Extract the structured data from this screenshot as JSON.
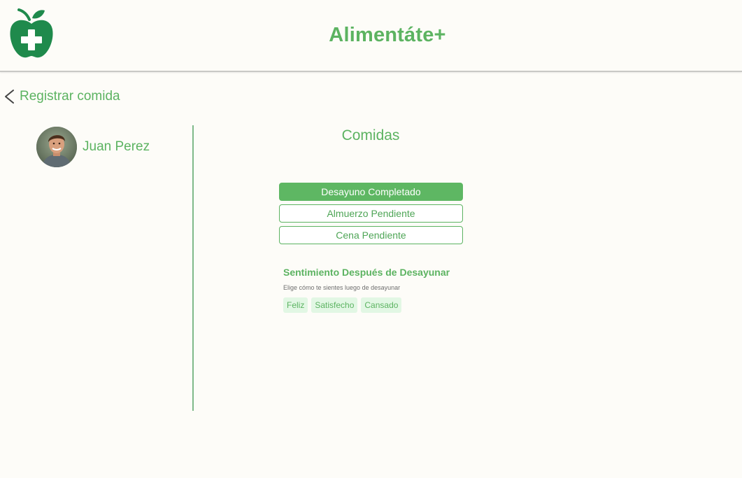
{
  "header": {
    "app_title": "Alimentáte+",
    "brand_color": "#5cb361",
    "logo_icon": "apple-plus-icon"
  },
  "nav": {
    "back_icon": "chevron-left-icon",
    "back_label": "Registrar comida"
  },
  "sidebar": {
    "user_name": "Juan Perez",
    "avatar_icon": "user-avatar"
  },
  "main": {
    "section_title": "Comidas",
    "meals": [
      {
        "label": "Desayuno Completado",
        "status": "completed"
      },
      {
        "label": "Almuerzo Pendiente",
        "status": "pending"
      },
      {
        "label": "Cena Pendiente",
        "status": "pending"
      }
    ],
    "feeling": {
      "title": "Sentimiento Después de Desayunar",
      "hint": "Elige cómo te sientes luego de desayunar",
      "options": [
        "Feliz",
        "Satisfecho",
        "Cansado"
      ]
    }
  }
}
